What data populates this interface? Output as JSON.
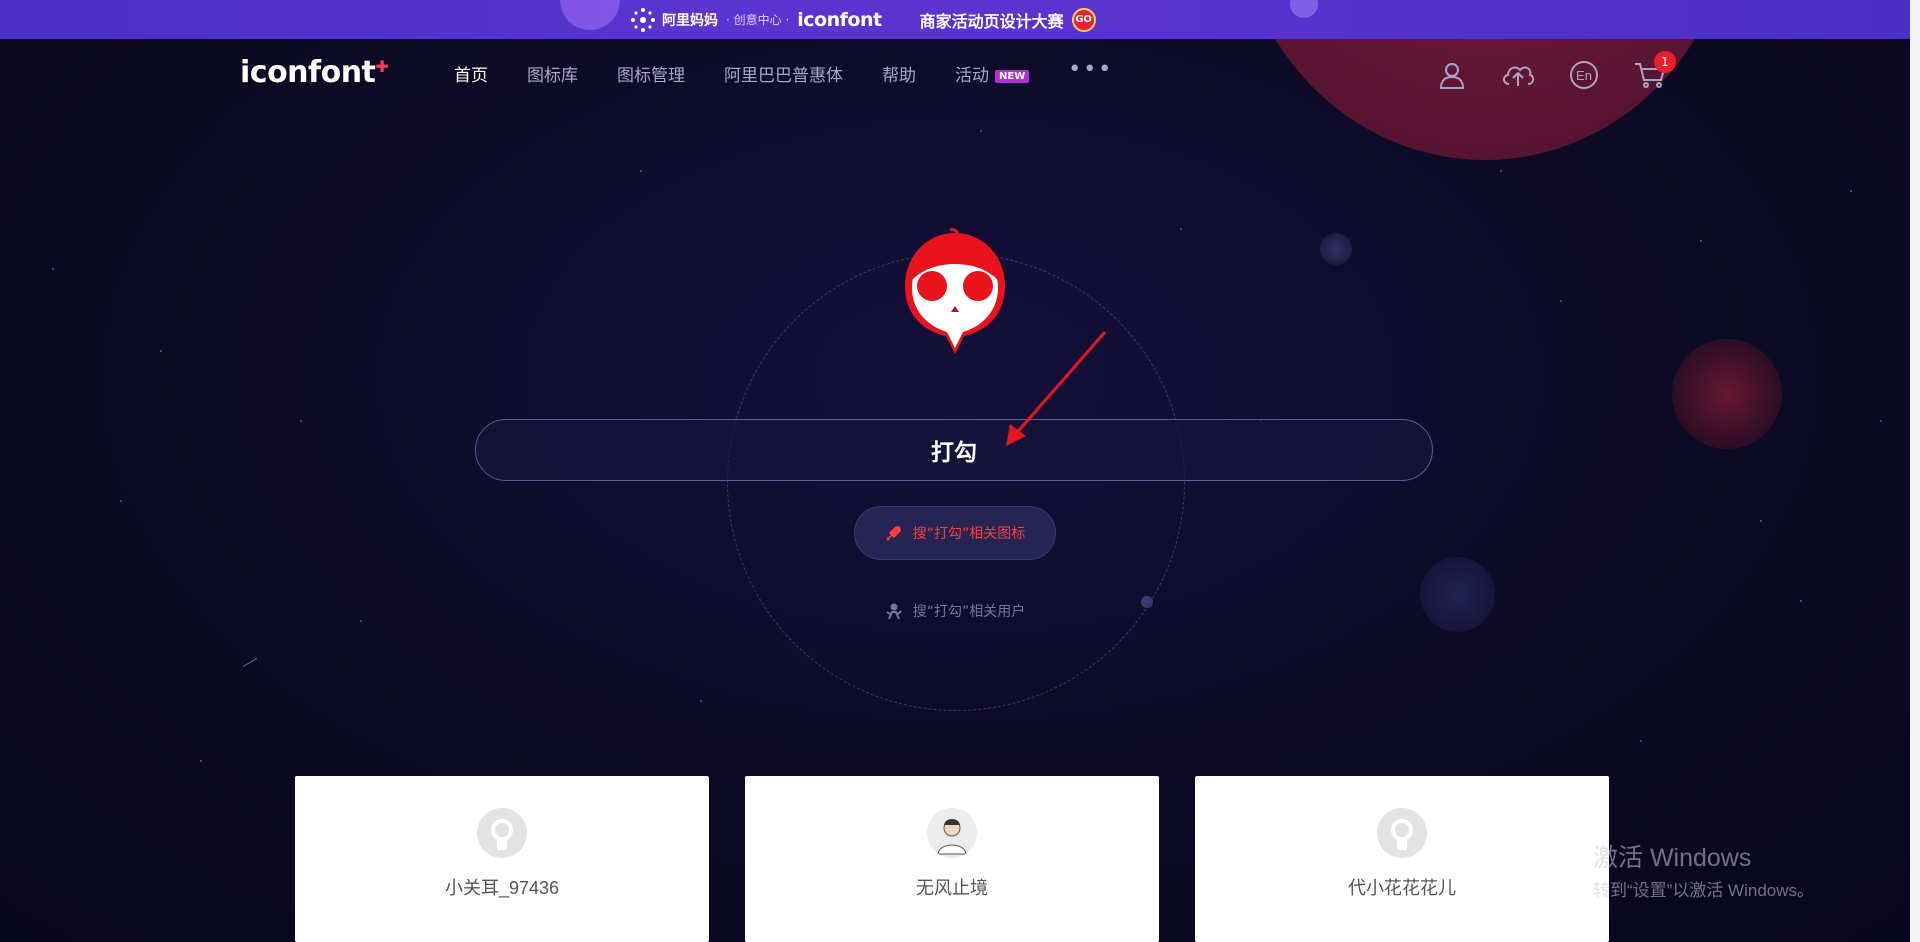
{
  "promo": {
    "brand1": "阿里妈妈",
    "sep": "· 创意中心 ·",
    "brand2": "iconfont",
    "campaign": "商家活动页设计大赛",
    "go": "GO"
  },
  "header": {
    "logo": "iconfont",
    "nav": [
      {
        "label": "首页"
      },
      {
        "label": "图标库"
      },
      {
        "label": "图标管理"
      },
      {
        "label": "阿里巴巴普惠体"
      },
      {
        "label": "帮助"
      },
      {
        "label": "活动"
      }
    ],
    "new_badge": "NEW",
    "more": "•••",
    "lang_label": "En",
    "cart_count": "1"
  },
  "search": {
    "value": "打勾"
  },
  "suggestions": {
    "icons": "搜“打勾”相关图标",
    "users": "搜“打勾”相关用户"
  },
  "cards": [
    {
      "name": "小关耳_97436"
    },
    {
      "name": "无风止境"
    },
    {
      "name": "代小花花花儿"
    }
  ],
  "watermark": {
    "line1": "激活 Windows",
    "line2": "转到“设置”以激活 Windows。"
  },
  "colors": {
    "background": "#0e0b27",
    "promo": "#5a33d0",
    "accent_red": "#ff3b3b",
    "badge_purple": "#b331d9"
  }
}
